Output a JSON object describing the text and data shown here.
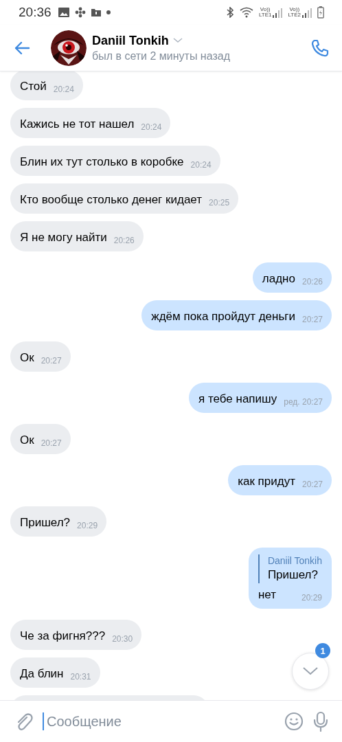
{
  "status_bar": {
    "time": "20:36",
    "sims": [
      {
        "top": "Vo))",
        "bottom": "LTE1"
      },
      {
        "top": "Vo))",
        "bottom": "LTE2"
      }
    ]
  },
  "header": {
    "name": "Daniil Tonkih",
    "status": "был в сети 2 минуты назад"
  },
  "messages": [
    {
      "outgoing": false,
      "kind": "text",
      "text": "Стой",
      "time": "20:24"
    },
    {
      "outgoing": false,
      "kind": "text",
      "text": "Кажись не тот нашел",
      "time": "20:24"
    },
    {
      "outgoing": false,
      "kind": "text",
      "text": "Блин их тут столько в коробке",
      "time": "20:24"
    },
    {
      "outgoing": false,
      "kind": "text",
      "text": "Кто вообще столько денег кидает",
      "time": "20:25"
    },
    {
      "outgoing": false,
      "kind": "text",
      "text": "Я не могу найти",
      "time": "20:26"
    },
    {
      "outgoing": true,
      "kind": "text",
      "text": "ладно",
      "time": "20:26"
    },
    {
      "outgoing": true,
      "kind": "text",
      "text": "ждём пока пройдут деньги",
      "time": "20:27"
    },
    {
      "outgoing": false,
      "kind": "text",
      "text": "Ок",
      "time": "20:27"
    },
    {
      "outgoing": true,
      "kind": "text",
      "text": "я тебе напишу",
      "time": "ред. 20:27"
    },
    {
      "outgoing": false,
      "kind": "text",
      "text": "Ок",
      "time": "20:27"
    },
    {
      "outgoing": true,
      "kind": "text",
      "text": "как придут",
      "time": "20:27"
    },
    {
      "outgoing": false,
      "kind": "text",
      "text": "Пришел?",
      "time": "20:29"
    },
    {
      "outgoing": true,
      "kind": "reply",
      "quote_author": "Daniil Tonkih",
      "quote_text": "Пришел?",
      "text": "нет",
      "time": "20:29"
    },
    {
      "outgoing": false,
      "kind": "text",
      "text": "Че за фигня???",
      "time": "20:30"
    },
    {
      "outgoing": false,
      "kind": "text",
      "text": "Да блин",
      "time": "20:31"
    },
    {
      "outgoing": false,
      "kind": "cut"
    }
  ],
  "scroll_down": {
    "badge": "1"
  },
  "composer": {
    "placeholder": "Сообщение"
  }
}
